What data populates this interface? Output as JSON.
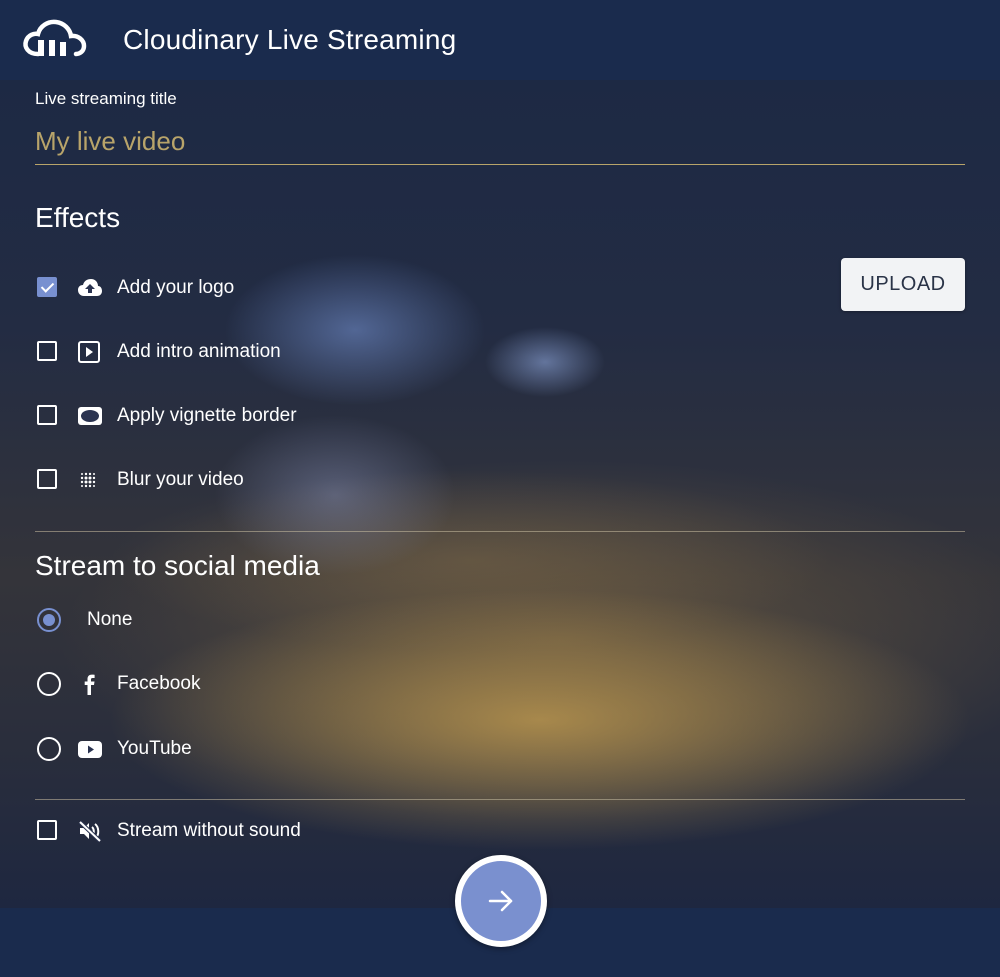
{
  "header": {
    "title": "Cloudinary Live Streaming",
    "logo_icon": "cloudinary-logo"
  },
  "form": {
    "title_label": "Live streaming title",
    "title_placeholder": "My live video",
    "effects_heading": "Effects",
    "upload_label": "UPLOAD",
    "effects": [
      {
        "label": "Add your logo",
        "icon": "cloud-upload-icon",
        "checked": true
      },
      {
        "label": "Add intro animation",
        "icon": "play-box-icon",
        "checked": false
      },
      {
        "label": "Apply vignette border",
        "icon": "vignette-icon",
        "checked": false
      },
      {
        "label": "Blur your video",
        "icon": "blur-icon",
        "checked": false
      }
    ],
    "social_heading": "Stream to social media",
    "social": [
      {
        "label": "None",
        "icon": "",
        "selected": true
      },
      {
        "label": "Facebook",
        "icon": "facebook-icon",
        "selected": false
      },
      {
        "label": "YouTube",
        "icon": "youtube-icon",
        "selected": false
      }
    ],
    "mute": {
      "label": "Stream without sound",
      "icon": "volume-off-icon",
      "checked": false
    }
  },
  "colors": {
    "accent": "#7890d0",
    "header_bg": "#1a2b4d",
    "input_gold": "#b8a46a"
  }
}
